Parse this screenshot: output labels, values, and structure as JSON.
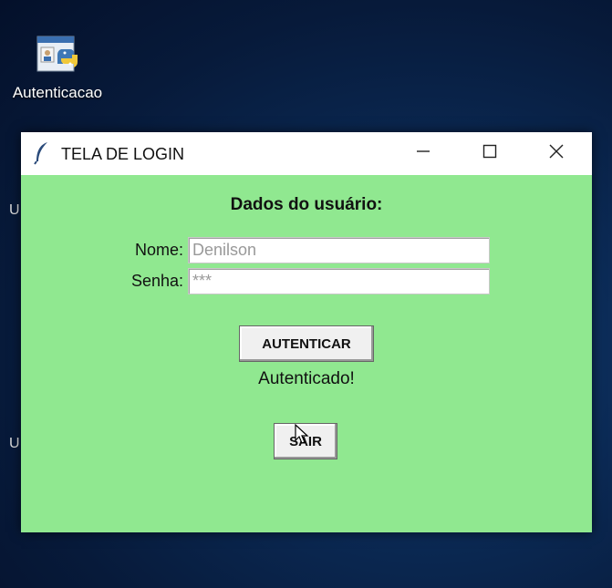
{
  "desktop": {
    "icon_label": "Autenticacao",
    "edge_letters": [
      "U",
      "U"
    ]
  },
  "window": {
    "title": "TELA DE LOGIN",
    "icon": "feather-icon",
    "controls": [
      "minimize-icon",
      "maximize-icon",
      "close-icon"
    ],
    "background_color": "#90e890"
  },
  "form": {
    "heading": "Dados do usuário:",
    "name_label": "Nome:",
    "name_value": "Denilson",
    "password_label": "Senha:",
    "password_value": "***",
    "authenticate_label": "AUTENTICAR",
    "status_text": "Autenticado!",
    "exit_label": "SAIR"
  }
}
